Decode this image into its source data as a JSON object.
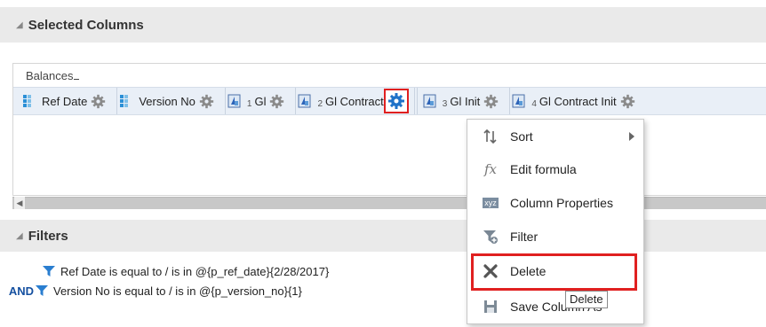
{
  "selected_columns": {
    "title": "Selected Columns",
    "subject_area": "Balances",
    "columns": [
      {
        "label": "Ref Date",
        "index": "",
        "kind": "attribute"
      },
      {
        "label": "Version No",
        "index": "",
        "kind": "attribute"
      },
      {
        "label": "Gl",
        "index": "1",
        "kind": "measure"
      },
      {
        "label": "Gl Contract",
        "index": "2",
        "kind": "measure"
      },
      {
        "label": "Gl Init",
        "index": "3",
        "kind": "measure"
      },
      {
        "label": "Gl Contract Init",
        "index": "4",
        "kind": "measure"
      }
    ]
  },
  "filters": {
    "title": "Filters",
    "rows": [
      {
        "connector": "",
        "text": "Ref Date is equal to / is in  @{p_ref_date}{2/28/2017}"
      },
      {
        "connector": "AND",
        "text": "Version No is equal to / is in  @{p_version_no}{1}"
      }
    ]
  },
  "context_menu": {
    "items": [
      {
        "label": "Sort",
        "icon": "sort-icon",
        "has_submenu": true
      },
      {
        "label": "Edit formula",
        "icon": "fx-icon",
        "has_submenu": false
      },
      {
        "label": "Column Properties",
        "icon": "xyz-icon",
        "has_submenu": false
      },
      {
        "label": "Filter",
        "icon": "filter-add-icon",
        "has_submenu": false
      },
      {
        "label": "Delete",
        "icon": "x-icon",
        "has_submenu": false,
        "highlighted": true
      },
      {
        "label": "Save Column As",
        "icon": "save-icon",
        "has_submenu": false
      }
    ]
  },
  "tooltip": {
    "text": "Delete"
  },
  "colors": {
    "highlight_red": "#e02020",
    "strip_bg": "#e9eff7",
    "header_bg": "#eaeaea",
    "and_blue": "#1550a0"
  }
}
